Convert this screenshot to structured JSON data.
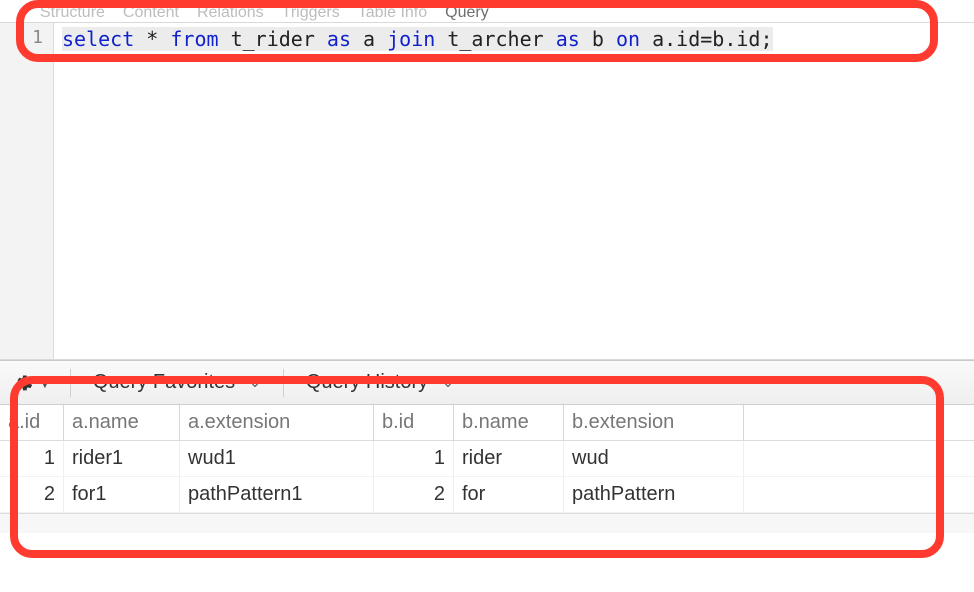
{
  "tabs": {
    "structure": "Structure",
    "content": "Content",
    "relations": "Relations",
    "triggers": "Triggers",
    "tableinfo": "Table Info",
    "query": "Query"
  },
  "editor": {
    "line_number": "1",
    "sql": {
      "k_select": "select",
      "star": " * ",
      "k_from": "from",
      "t1": " t_rider ",
      "k_as1": "as",
      "a1": " a ",
      "k_join": "join",
      "t2": " t_archer ",
      "k_as2": "as",
      "a2": " b ",
      "k_on": "on",
      "cond": " a.id=b.id;"
    }
  },
  "toolbar": {
    "favorites_label": "Query Favorites",
    "history_label": "Query History"
  },
  "columns": {
    "aid": "a.id",
    "aname": "a.name",
    "aext": "a.extension",
    "bid": "b.id",
    "bname": "b.name",
    "bext": "b.extension"
  },
  "rows": [
    {
      "aid": "1",
      "aname": "rider1",
      "aext": "wud1",
      "bid": "1",
      "bname": "rider",
      "bext": "wud"
    },
    {
      "aid": "2",
      "aname": "for1",
      "aext": "pathPattern1",
      "bid": "2",
      "bname": "for",
      "bext": "pathPattern"
    }
  ]
}
